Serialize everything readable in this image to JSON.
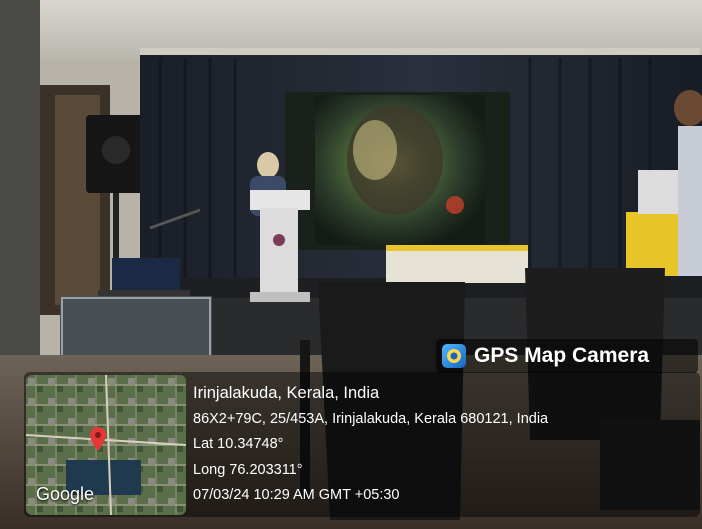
{
  "scene": {
    "description_tag": "photo"
  },
  "watermark": {
    "app_name": "GPS Map Camera",
    "app_icon": "gps-map-camera-icon",
    "map_brand": "Google",
    "map_pin_icon": "map-pin-icon",
    "place": "Irinjalakuda, Kerala, India",
    "address": "86X2+79C, 25/453A, Irinjalakuda, Kerala 680121, India",
    "lat": "Lat 10.34748°",
    "long": "Long 76.203311°",
    "datetime": "07/03/24 10:29 AM GMT +05:30"
  },
  "colors": {
    "curtain": "#1f2430",
    "stage_floor": "#26282b",
    "table_cloth_yellow": "#e8c62a",
    "pin_red": "#e53935"
  }
}
